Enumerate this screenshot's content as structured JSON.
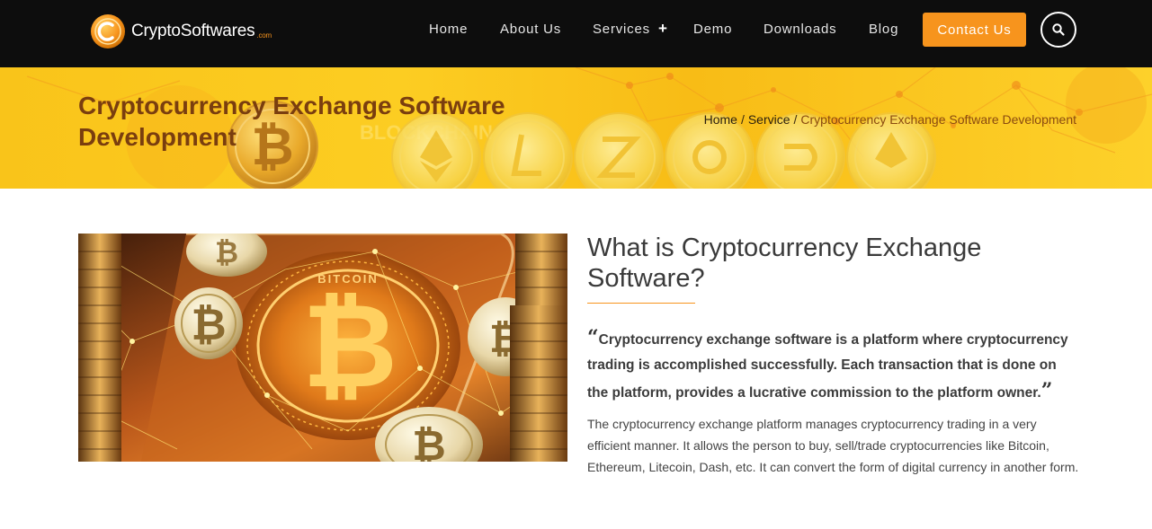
{
  "header": {
    "logo": {
      "name": "CryptoSoftwares",
      "suffix": ".com"
    },
    "nav": [
      {
        "label": "Home"
      },
      {
        "label": "About Us"
      },
      {
        "label": "Services"
      },
      {
        "label": "Demo"
      },
      {
        "label": "Downloads"
      },
      {
        "label": "Blog"
      }
    ],
    "services_expand_icon": "plus-icon",
    "contact_label": "Contact Us",
    "search_icon": "search-icon"
  },
  "banner": {
    "title": "Cryptocurrency Exchange Software Development",
    "breadcrumb": {
      "home": "Home",
      "service": "Service",
      "separator": "/",
      "current": "Cryptocurrency Exchange Software Development"
    }
  },
  "main": {
    "heading": "What is Cryptocurrency Exchange Software?",
    "quote": "Cryptocurrency exchange software is a platform where cryptocurrency trading is accomplished successfully. Each transaction that is done on the platform, provides a lucrative commission to the platform owner.",
    "quote_open": "“",
    "quote_close": "”",
    "paragraph": "The cryptocurrency exchange platform manages cryptocurrency trading in a very efficient manner. It allows the person to buy, sell/trade cryptocurrencies like Bitcoin, Ethereum, Litecoin, Dash, etc. It can convert the form of digital currency in another form."
  },
  "colors": {
    "header_bg": "#0d0d0d",
    "accent": "#f7941d",
    "banner_yellow": "#fccd22",
    "banner_title": "#7a3e0f"
  }
}
